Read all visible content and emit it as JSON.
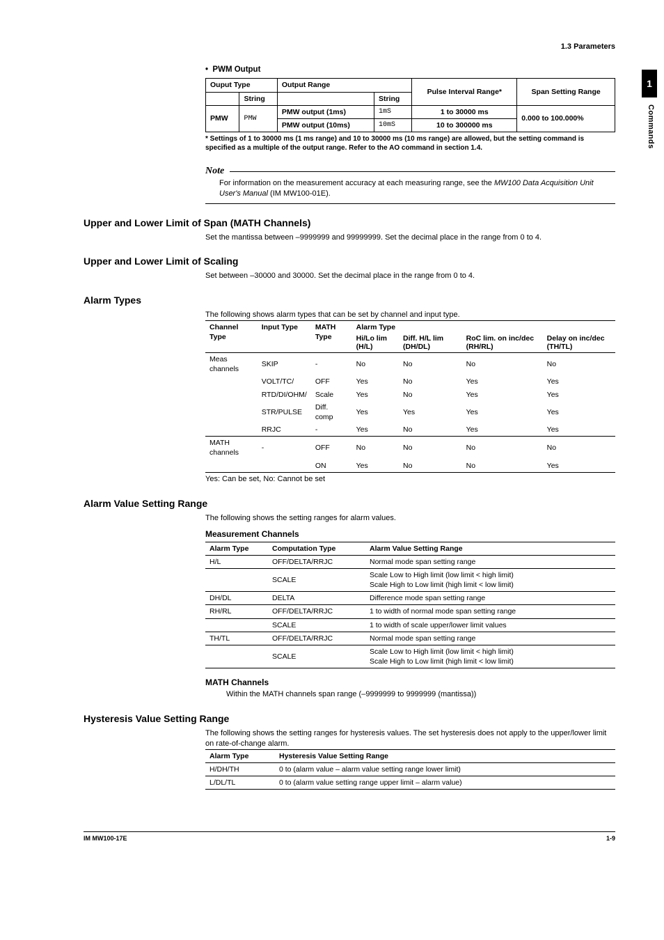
{
  "header": {
    "section_ref": "1.3  Parameters"
  },
  "side": {
    "tab_number": "1",
    "tab_label": "Commands"
  },
  "pwm": {
    "bullet_title": "PWM Output",
    "head_output_type": "Ouput Type",
    "head_output_range": "Output Range",
    "head_pulse_interval": "Pulse Interval Range*",
    "head_span_setting": "Span Setting Range",
    "head_string": "String",
    "row1_type": "PMW",
    "row1_string": "PMW",
    "row1_range_label": "PMW output (1ms)",
    "row1_range_string": "1mS",
    "row1_pulse": "1 to     30000 ms",
    "row2_range_label": "PMW output (10ms)",
    "row2_range_string": "10mS",
    "row2_pulse": "10 to   300000 ms",
    "span_range": "0.000 to 100.000%",
    "footnote": "* Settings of 1 to 30000 ms (1 ms range) and 10 to 30000 ms (10 ms range) are allowed, but the setting command is specified as a multiple of the output range. Refer to the AO command in section 1.4."
  },
  "note": {
    "title": "Note",
    "body_pre": "For information on the measurement accuracy at each measuring range, see the ",
    "body_em": "MW100 Data Acquisition Unit User's Manual",
    "body_post": " (IM MW100-01E)."
  },
  "span": {
    "title": "Upper and Lower Limit of Span (MATH Channels)",
    "body": "Set the mantissa between –9999999 and 99999999. Set the decimal place in the range from 0 to 4."
  },
  "scaling": {
    "title": "Upper and Lower Limit of Scaling",
    "body": "Set between –30000 and 30000. Set the decimal place in the range from 0 to 4."
  },
  "alarm_types": {
    "title": "Alarm Types",
    "intro": "The following shows alarm types that can be set by channel and input type.",
    "head": {
      "channel_type": "Channel Type",
      "input_type": "Input Type",
      "math_type": "MATH Type",
      "alarm_type": "Alarm Type",
      "hilo": "Hi/Lo lim (H/L)",
      "diff": "Diff. H/L lim (DH/DL)",
      "roc": "RoC lim. on inc/dec (RH/RL)",
      "delay": "Delay on inc/dec (TH/TL)"
    },
    "rows": [
      {
        "chan": "Meas channels",
        "input": "SKIP",
        "math": "-",
        "hilo": "No",
        "diff": "No",
        "roc": "No",
        "delay": "No"
      },
      {
        "chan": "",
        "input": "VOLT/TC/",
        "math": "OFF",
        "hilo": "Yes",
        "diff": "No",
        "roc": "Yes",
        "delay": "Yes"
      },
      {
        "chan": "",
        "input": "RTD/DI/OHM/",
        "math": "Scale",
        "hilo": "Yes",
        "diff": "No",
        "roc": "Yes",
        "delay": "Yes"
      },
      {
        "chan": "",
        "input": "STR/PULSE",
        "math": "Diff. comp",
        "hilo": "Yes",
        "diff": "Yes",
        "roc": "Yes",
        "delay": "Yes"
      },
      {
        "chan": "",
        "input": "RRJC",
        "math": "-",
        "hilo": "Yes",
        "diff": "No",
        "roc": "Yes",
        "delay": "Yes"
      },
      {
        "chan": "MATH channels",
        "input": "-",
        "math": "OFF",
        "hilo": "No",
        "diff": "No",
        "roc": "No",
        "delay": "No"
      },
      {
        "chan": "",
        "input": "",
        "math": "ON",
        "hilo": "Yes",
        "diff": "No",
        "roc": "No",
        "delay": "Yes"
      }
    ],
    "foot": "Yes: Can be set, No: Cannot be set"
  },
  "avr": {
    "title": "Alarm Value Setting Range",
    "intro": "The following shows the setting ranges for alarm values.",
    "meas_title": "Measurement Channels",
    "head_alarm": "Alarm Type",
    "head_comp": "Computation Type",
    "head_range": "Alarm Value Setting Range",
    "rows": [
      {
        "alarm": "H/L",
        "comp": "OFF/DELTA/RRJC",
        "range": "Normal mode span setting range"
      },
      {
        "alarm": "",
        "comp": "SCALE",
        "range": "Scale Low to High limit (low limit < high limit)\nScale High to Low limit (high limit < low limit)"
      },
      {
        "alarm": "DH/DL",
        "comp": "DELTA",
        "range": "Difference mode span setting range"
      },
      {
        "alarm": "RH/RL",
        "comp": "OFF/DELTA/RRJC",
        "range": "1 to width of normal mode span setting range"
      },
      {
        "alarm": "",
        "comp": "SCALE",
        "range": "1 to width of scale upper/lower limit values"
      },
      {
        "alarm": "TH/TL",
        "comp": "OFF/DELTA/RRJC",
        "range": "Normal mode span setting range"
      },
      {
        "alarm": "",
        "comp": "SCALE",
        "range": "Scale Low to High limit (low limit < high limit)\nScale High to Low limit (high limit < low limit)"
      }
    ],
    "math_title": "MATH Channels",
    "math_body": "Within the MATH channels span range (–9999999 to 9999999 (mantissa))"
  },
  "hyst": {
    "title": "Hysteresis Value Setting Range",
    "intro": "The following shows the setting ranges for hysteresis values. The set hysteresis does not apply to the upper/lower limit on rate-of-change alarm.",
    "head_alarm": "Alarm Type",
    "head_range": "Hysteresis Value Setting Range",
    "rows": [
      {
        "alarm": "H/DH/TH",
        "range": "0 to (alarm value – alarm value setting range lower limit)"
      },
      {
        "alarm": "L/DL/TL",
        "range": "0 to (alarm value setting range upper limit – alarm value)"
      }
    ]
  },
  "footer": {
    "left": "IM MW100-17E",
    "right": "1-9"
  }
}
